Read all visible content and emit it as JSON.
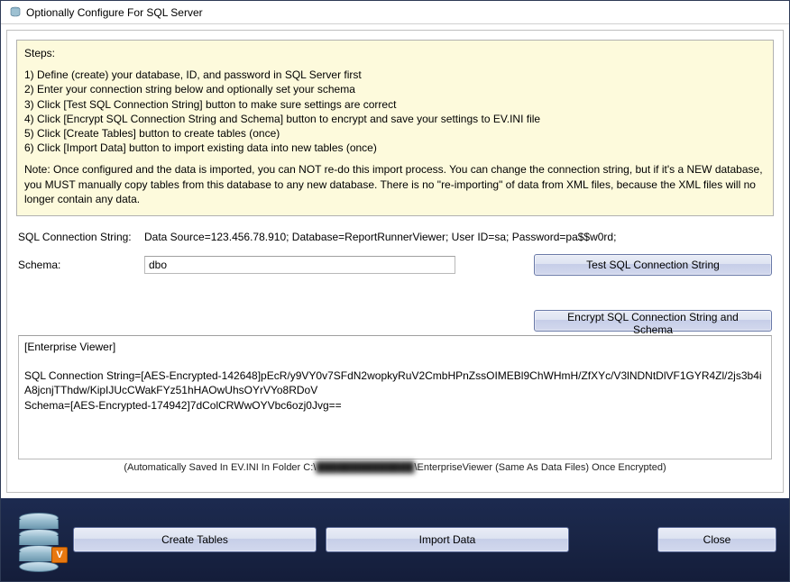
{
  "window": {
    "title": "Optionally Configure For SQL Server"
  },
  "steps": {
    "heading": "Steps:",
    "lines": [
      "1) Define (create) your database, ID, and password in SQL Server first",
      "2) Enter your connection string below and optionally set your schema",
      "3) Click [Test SQL Connection String] button to make sure settings are correct",
      "4) Click [Encrypt SQL Connection String and Schema] button to encrypt and save your settings to EV.INI file",
      "5) Click [Create Tables] button to create tables (once)",
      "6) Click [Import Data] button to import existing data into new tables (once)"
    ],
    "note": "Note: Once configured and the data is imported, you can NOT re-do this import process. You can change the connection string, but if it's a NEW database, you MUST manually copy tables from this database to any new database. There is no \"re-importing\" of data from XML files, because the XML files will no longer contain any data."
  },
  "form": {
    "conn_label": "SQL Connection String:",
    "conn_value": "Data Source=123.456.78.910; Database=ReportRunnerViewer; User ID=sa; Password=pa$$w0rd;",
    "schema_label": "Schema:",
    "schema_value": "dbo",
    "test_button": "Test SQL Connection String",
    "encrypt_button": "Encrypt SQL Connection String and Schema"
  },
  "log": {
    "text": "[Enterprise Viewer]\n\nSQL Connection String=[AES-Encrypted-142648]pEcR/y9VY0v7SFdN2wopkyRuV2CmbHPnZssOIMEBl9ChWHmH/ZfXYc/V3lNDNtDlVF1GYR4Zl/2js3b4iA8jcnjTThdw/KipIJUcCWakFYz51hHAOwUhsOYrVYo8RDoV\nSchema=[AES-Encrypted-174942]7dColCRWwOYVbc6ozj0Jvg=="
  },
  "saved_note": {
    "prefix": "(Automatically Saved In EV.INI In Folder C:\\",
    "blurred": "██████████████",
    "suffix": "\\EnterpriseViewer (Same As Data Files) Once Encrypted)"
  },
  "footer": {
    "create_tables": "Create Tables",
    "import_data": "Import Data",
    "close": "Close",
    "badge": "V"
  }
}
